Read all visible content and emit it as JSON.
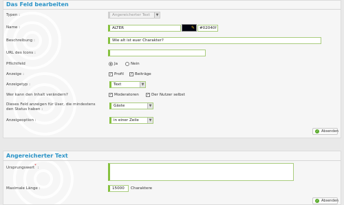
{
  "section1": {
    "title": "Das Feld bearbeiten",
    "type": {
      "label": "Typen :",
      "value": "Angereicherter Text"
    },
    "name": {
      "label": "Name :",
      "value": "ALTER",
      "color_value": "#02040f",
      "color_swatch": "#02040f"
    },
    "description": {
      "label": "Beschreibung :",
      "value": "Wie alt ist euer Charakter?"
    },
    "icon_url": {
      "label": "URL des Icons :",
      "value": ""
    },
    "required": {
      "label": "Pflichtfeld",
      "options": [
        "Ja",
        "Nein"
      ],
      "selected": "Ja"
    },
    "display": {
      "label": "Anzeige :",
      "options": [
        "Profil",
        "Beiträge"
      ],
      "checked": [
        true,
        true
      ]
    },
    "display_type": {
      "label": "Anzeigetyp :",
      "value": "Text"
    },
    "who_can_see": {
      "label": "Wer kann den Inhalt verändern?",
      "options": [
        "Moderatoren",
        "Der Nutzer selbst"
      ],
      "checked": [
        true,
        true
      ]
    },
    "show_for": {
      "label": "Dieses Feld anzeigen für User, die mindestens den Status haben :",
      "value": "Gäste"
    },
    "display_option": {
      "label": "Anzeigeoption :",
      "value": "in einer Zeile"
    },
    "submit_label": "Absenden"
  },
  "section2": {
    "title": "Angereicherter Text",
    "default_value": {
      "label": "Ursprungswert",
      "required_mark": "*",
      "suffix": " :",
      "value": ""
    },
    "max_length": {
      "label": "Maximale Länge :",
      "value": "15000",
      "unit": "Charaktere"
    },
    "submit_label": "Absenden"
  },
  "colors": {
    "title_blue": "#2a93c7",
    "field_green": "#86c13f",
    "button_green": "#5aab2c",
    "required_star": "#d21f1f"
  },
  "icons": {
    "submit": "check-circle-icon",
    "color_picker": "color-picker-icon",
    "dropdown": "chevron-down-icon",
    "decoration": "swirl-decoration"
  }
}
